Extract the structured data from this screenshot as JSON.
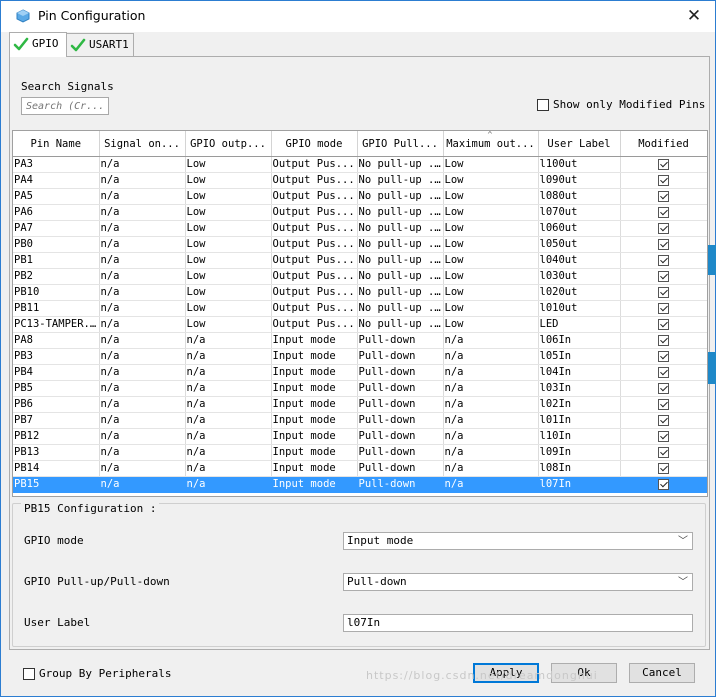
{
  "window": {
    "title": "Pin Configuration",
    "close_label": "✕"
  },
  "tabs": [
    {
      "label": "GPIO",
      "active": true
    },
    {
      "label": "USART1",
      "active": false
    }
  ],
  "search": {
    "label": "Search Signals",
    "placeholder": "Search (Cr..."
  },
  "show_modified": {
    "label": "Show only Modified Pins",
    "checked": false
  },
  "table": {
    "columns": [
      "Pin Name",
      "Signal on...",
      "GPIO outp...",
      "GPIO mode",
      "GPIO Pull...",
      "Maximum out...",
      "User Label",
      "Modified"
    ],
    "rows": [
      {
        "pin": "PA3",
        "signal": "n/a",
        "output": "Low",
        "mode": "Output Pus...",
        "pull": "No pull-up ...",
        "speed": "Low",
        "label": "l100ut",
        "modified": true
      },
      {
        "pin": "PA4",
        "signal": "n/a",
        "output": "Low",
        "mode": "Output Pus...",
        "pull": "No pull-up ...",
        "speed": "Low",
        "label": "l090ut",
        "modified": true
      },
      {
        "pin": "PA5",
        "signal": "n/a",
        "output": "Low",
        "mode": "Output Pus...",
        "pull": "No pull-up ...",
        "speed": "Low",
        "label": "l080ut",
        "modified": true
      },
      {
        "pin": "PA6",
        "signal": "n/a",
        "output": "Low",
        "mode": "Output Pus...",
        "pull": "No pull-up ...",
        "speed": "Low",
        "label": "l070ut",
        "modified": true
      },
      {
        "pin": "PA7",
        "signal": "n/a",
        "output": "Low",
        "mode": "Output Pus...",
        "pull": "No pull-up ...",
        "speed": "Low",
        "label": "l060ut",
        "modified": true
      },
      {
        "pin": "PB0",
        "signal": "n/a",
        "output": "Low",
        "mode": "Output Pus...",
        "pull": "No pull-up ...",
        "speed": "Low",
        "label": "l050ut",
        "modified": true
      },
      {
        "pin": "PB1",
        "signal": "n/a",
        "output": "Low",
        "mode": "Output Pus...",
        "pull": "No pull-up ...",
        "speed": "Low",
        "label": "l040ut",
        "modified": true
      },
      {
        "pin": "PB2",
        "signal": "n/a",
        "output": "Low",
        "mode": "Output Pus...",
        "pull": "No pull-up ...",
        "speed": "Low",
        "label": "l030ut",
        "modified": true
      },
      {
        "pin": "PB10",
        "signal": "n/a",
        "output": "Low",
        "mode": "Output Pus...",
        "pull": "No pull-up ...",
        "speed": "Low",
        "label": "l020ut",
        "modified": true
      },
      {
        "pin": "PB11",
        "signal": "n/a",
        "output": "Low",
        "mode": "Output Pus...",
        "pull": "No pull-up ...",
        "speed": "Low",
        "label": "l010ut",
        "modified": true
      },
      {
        "pin": "PC13-TAMPER...",
        "signal": "n/a",
        "output": "Low",
        "mode": "Output Pus...",
        "pull": "No pull-up ...",
        "speed": "Low",
        "label": "LED",
        "modified": true
      },
      {
        "pin": "PA8",
        "signal": "n/a",
        "output": "n/a",
        "mode": "Input mode",
        "pull": "Pull-down",
        "speed": "n/a",
        "label": "l06In",
        "modified": true
      },
      {
        "pin": "PB3",
        "signal": "n/a",
        "output": "n/a",
        "mode": "Input mode",
        "pull": "Pull-down",
        "speed": "n/a",
        "label": "l05In",
        "modified": true
      },
      {
        "pin": "PB4",
        "signal": "n/a",
        "output": "n/a",
        "mode": "Input mode",
        "pull": "Pull-down",
        "speed": "n/a",
        "label": "l04In",
        "modified": true
      },
      {
        "pin": "PB5",
        "signal": "n/a",
        "output": "n/a",
        "mode": "Input mode",
        "pull": "Pull-down",
        "speed": "n/a",
        "label": "l03In",
        "modified": true
      },
      {
        "pin": "PB6",
        "signal": "n/a",
        "output": "n/a",
        "mode": "Input mode",
        "pull": "Pull-down",
        "speed": "n/a",
        "label": "l02In",
        "modified": true
      },
      {
        "pin": "PB7",
        "signal": "n/a",
        "output": "n/a",
        "mode": "Input mode",
        "pull": "Pull-down",
        "speed": "n/a",
        "label": "l01In",
        "modified": true
      },
      {
        "pin": "PB12",
        "signal": "n/a",
        "output": "n/a",
        "mode": "Input mode",
        "pull": "Pull-down",
        "speed": "n/a",
        "label": "l10In",
        "modified": true
      },
      {
        "pin": "PB13",
        "signal": "n/a",
        "output": "n/a",
        "mode": "Input mode",
        "pull": "Pull-down",
        "speed": "n/a",
        "label": "l09In",
        "modified": true
      },
      {
        "pin": "PB14",
        "signal": "n/a",
        "output": "n/a",
        "mode": "Input mode",
        "pull": "Pull-down",
        "speed": "n/a",
        "label": "l08In",
        "modified": true
      },
      {
        "pin": "PB15",
        "signal": "n/a",
        "output": "n/a",
        "mode": "Input mode",
        "pull": "Pull-down",
        "speed": "n/a",
        "label": "l07In",
        "modified": true,
        "selected": true
      }
    ]
  },
  "config": {
    "title": "PB15 Configuration :",
    "gpio_mode_label": "GPIO mode",
    "gpio_mode_value": "Input mode",
    "pull_label": "GPIO Pull-up/Pull-down",
    "pull_value": "Pull-down",
    "user_label_label": "User Label",
    "user_label_value": "l07In"
  },
  "footer": {
    "group_label": "Group By Peripherals",
    "group_checked": false,
    "apply": "Apply",
    "ok": "Ok",
    "cancel": "Cancel"
  },
  "watermark": "https://blog.csdn.net/dreamdonghui",
  "colors": {
    "selection": "#3399ff",
    "window_border": "#2c7dd1",
    "check_green": "#2fb844"
  }
}
